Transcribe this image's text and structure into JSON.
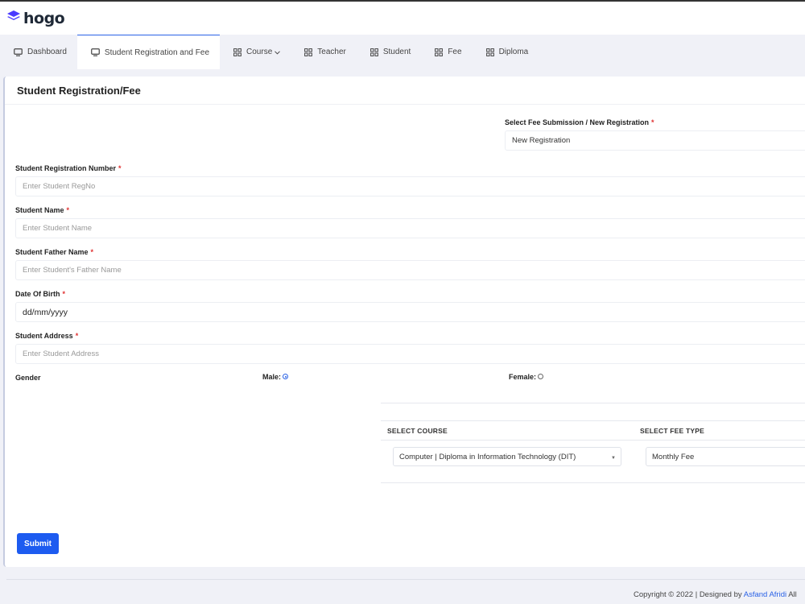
{
  "app": {
    "brand": "hogo",
    "brand_color": "#4a3aff"
  },
  "nav": [
    {
      "label": "Dashboard",
      "icon": "monitor-icon",
      "active": false
    },
    {
      "label": "Student Registration and Fee",
      "icon": "monitor-icon",
      "active": true
    },
    {
      "label": "Course",
      "icon": "grid-icon",
      "active": false,
      "dropdown": true
    },
    {
      "label": "Teacher",
      "icon": "grid-icon",
      "active": false
    },
    {
      "label": "Student",
      "icon": "grid-icon",
      "active": false
    },
    {
      "label": "Fee",
      "icon": "grid-icon",
      "active": false
    },
    {
      "label": "Diploma",
      "icon": "grid-icon",
      "active": false
    }
  ],
  "form": {
    "title": "Student Registration/Fee",
    "submission_type": {
      "label": "Select Fee Submission / New Registration",
      "value": "New Registration"
    },
    "reg_no": {
      "label": "Student Registration Number",
      "placeholder": "Enter Student RegNo"
    },
    "name": {
      "label": "Student Name",
      "placeholder": "Enter Student Name"
    },
    "father_name": {
      "label": "Student Father Name",
      "placeholder": "Enter Student's Father Name"
    },
    "dob": {
      "label": "Date Of Birth",
      "value": "dd/mm/yyyy"
    },
    "address": {
      "label": "Student Address",
      "placeholder": "Enter Student Address"
    },
    "gender": {
      "label": "Gender",
      "male": "Male:",
      "female": "Female:",
      "selected": "male"
    },
    "course": {
      "header": "SELECT COURSE",
      "value": "Computer | Diploma in Information Technology (DIT)"
    },
    "fee_type": {
      "header": "SELECT FEE TYPE",
      "value": "Monthly Fee"
    },
    "submit": "Submit",
    "required_mark": "*"
  },
  "footer": {
    "text": "Copyright © 2022 | Designed by ",
    "author": "Asfand Afridi",
    "suffix": " All"
  },
  "colors": {
    "accent": "#1d5bf0",
    "required": "#e03131",
    "background": "#f0f1f7"
  }
}
